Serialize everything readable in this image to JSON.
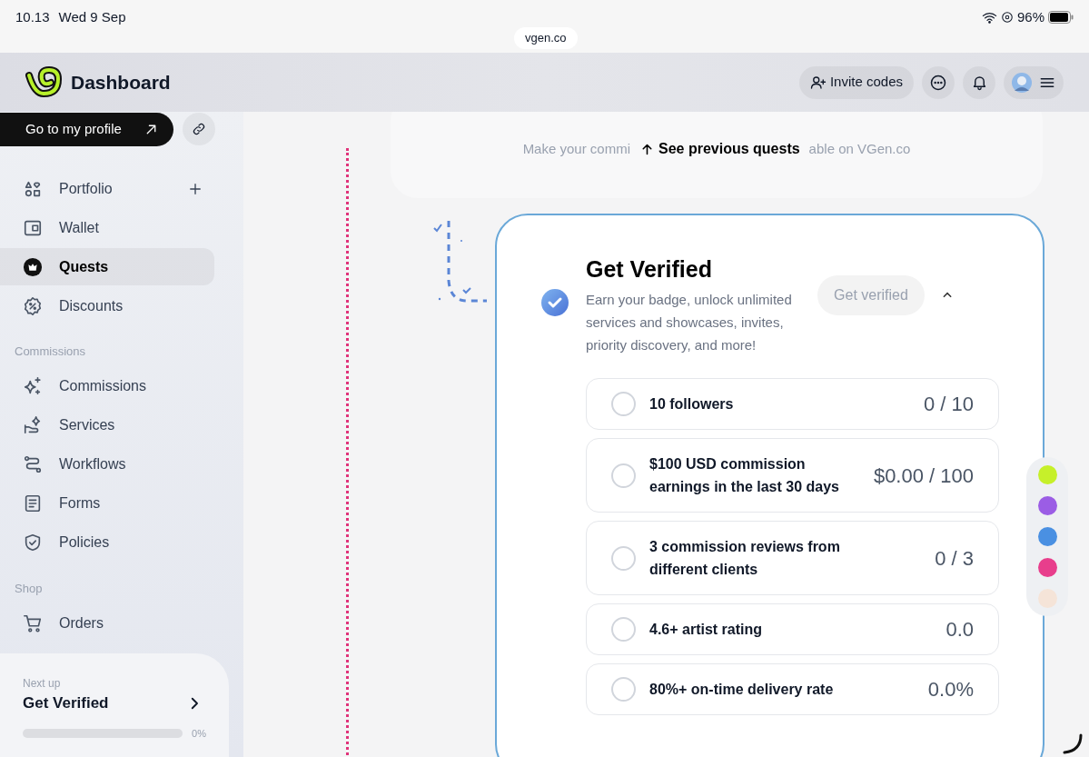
{
  "status_bar": {
    "time": "10.13",
    "date": "Wed 9 Sep",
    "battery": "96%",
    "url": "vgen.co"
  },
  "header": {
    "title": "Dashboard",
    "invite_button": "Invite codes"
  },
  "sidebar": {
    "profile_button": "Go to my profile",
    "sections": [
      {
        "items": [
          {
            "label": "Portfolio",
            "selected": false,
            "has_add": true
          },
          {
            "label": "Wallet",
            "selected": false
          },
          {
            "label": "Quests",
            "selected": true
          },
          {
            "label": "Discounts",
            "selected": false
          }
        ]
      },
      {
        "heading": "Commissions",
        "items": [
          {
            "label": "Commissions",
            "selected": false
          },
          {
            "label": "Services",
            "selected": false
          },
          {
            "label": "Workflows",
            "selected": false
          },
          {
            "label": "Forms",
            "selected": false
          },
          {
            "label": "Policies",
            "selected": false
          }
        ]
      },
      {
        "heading": "Shop",
        "items": [
          {
            "label": "Orders",
            "selected": false
          }
        ]
      }
    ],
    "next_up": {
      "label": "Next up",
      "title": "Get Verified",
      "level": 0,
      "reading": "0%"
    }
  },
  "main": {
    "see_previous": "See previous quests",
    "faded_text": [
      "Make your commi",
      "able on VGen.co"
    ],
    "quest": {
      "title": "Get Verified",
      "description": "Earn your badge, unlock unlimited services and showcases, invites, priority discovery, and more!",
      "button": "Get verified",
      "expanded": true,
      "tasks": [
        {
          "label": "10 followers",
          "value": "0 / 10",
          "done": false
        },
        {
          "label": "$100 USD commission earnings in the last 30 days",
          "value": "$0.00 / 100",
          "done": false
        },
        {
          "label": "3 commission reviews from different clients",
          "value": "0 / 3",
          "done": false
        },
        {
          "label": "4.6+ artist rating",
          "value": "0.0",
          "done": false
        },
        {
          "label": "80%+ on-time delivery rate",
          "value": "0.0%",
          "done": false
        }
      ]
    },
    "quest_rail": [
      {
        "color": "#c6f02a"
      },
      {
        "color": "#9b5de5"
      },
      {
        "color": "#4a90e2"
      },
      {
        "color": "#e83e8c"
      },
      {
        "color": "#f5e4d8"
      }
    ]
  }
}
